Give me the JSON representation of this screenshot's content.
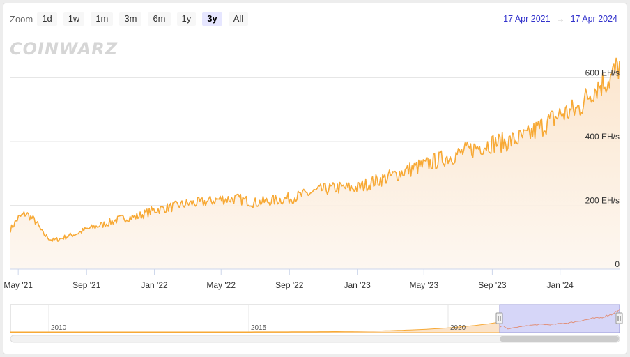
{
  "toolbar": {
    "zoom_label": "Zoom",
    "buttons": [
      "1d",
      "1w",
      "1m",
      "3m",
      "6m",
      "1y",
      "3y",
      "All"
    ],
    "active": "3y"
  },
  "range": {
    "from": "17 Apr 2021",
    "arrow": "→",
    "to": "17 Apr 2024"
  },
  "watermark": "COINWARZ",
  "colors": {
    "line": "#f7a935",
    "fill_top": "#fbe8d2",
    "grid": "#e6e6e6",
    "nav_mask": "#c8c8f5",
    "range_text": "#3333cc"
  },
  "chart_data": {
    "type": "area",
    "ylabel": "",
    "y_unit": "EH/s",
    "ylim": [
      0,
      730
    ],
    "y_ticks": [
      "0",
      "200 EH/s",
      "400 EH/s",
      "600 EH/s"
    ],
    "x_ticks": [
      "May '21",
      "Sep '21",
      "Jan '22",
      "May '22",
      "Sep '22",
      "Jan '23",
      "May '23",
      "Sep '23",
      "Jan '24"
    ],
    "x_range": [
      "2021-04-17",
      "2024-04-17"
    ],
    "series": [
      {
        "x": [
          "2021-04-17",
          "2021-05-01",
          "2021-05-15",
          "2021-06-01",
          "2021-06-15",
          "2021-07-01",
          "2021-07-15",
          "2021-08-01",
          "2021-08-15",
          "2021-09-01",
          "2021-10-01",
          "2021-11-01",
          "2021-12-01",
          "2022-01-01",
          "2022-02-01",
          "2022-03-01",
          "2022-04-01",
          "2022-05-01",
          "2022-06-01",
          "2022-07-01",
          "2022-08-01",
          "2022-09-01",
          "2022-10-01",
          "2022-11-01",
          "2022-12-01",
          "2023-01-01",
          "2023-02-01",
          "2023-03-01",
          "2023-04-01",
          "2023-05-01",
          "2023-06-01",
          "2023-07-01",
          "2023-08-01",
          "2023-09-01",
          "2023-10-01",
          "2023-11-01",
          "2023-12-01",
          "2024-01-01",
          "2024-02-01",
          "2024-03-01",
          "2024-04-01",
          "2024-04-17"
        ],
        "values": [
          125,
          160,
          175,
          150,
          110,
          90,
          95,
          105,
          112,
          125,
          140,
          158,
          165,
          185,
          195,
          205,
          210,
          220,
          220,
          208,
          215,
          222,
          235,
          250,
          255,
          255,
          275,
          290,
          310,
          325,
          345,
          360,
          380,
          395,
          400,
          415,
          450,
          485,
          500,
          565,
          600,
          640
        ]
      }
    ]
  },
  "navigator": {
    "labels": [
      "2010",
      "2015",
      "2020"
    ]
  }
}
